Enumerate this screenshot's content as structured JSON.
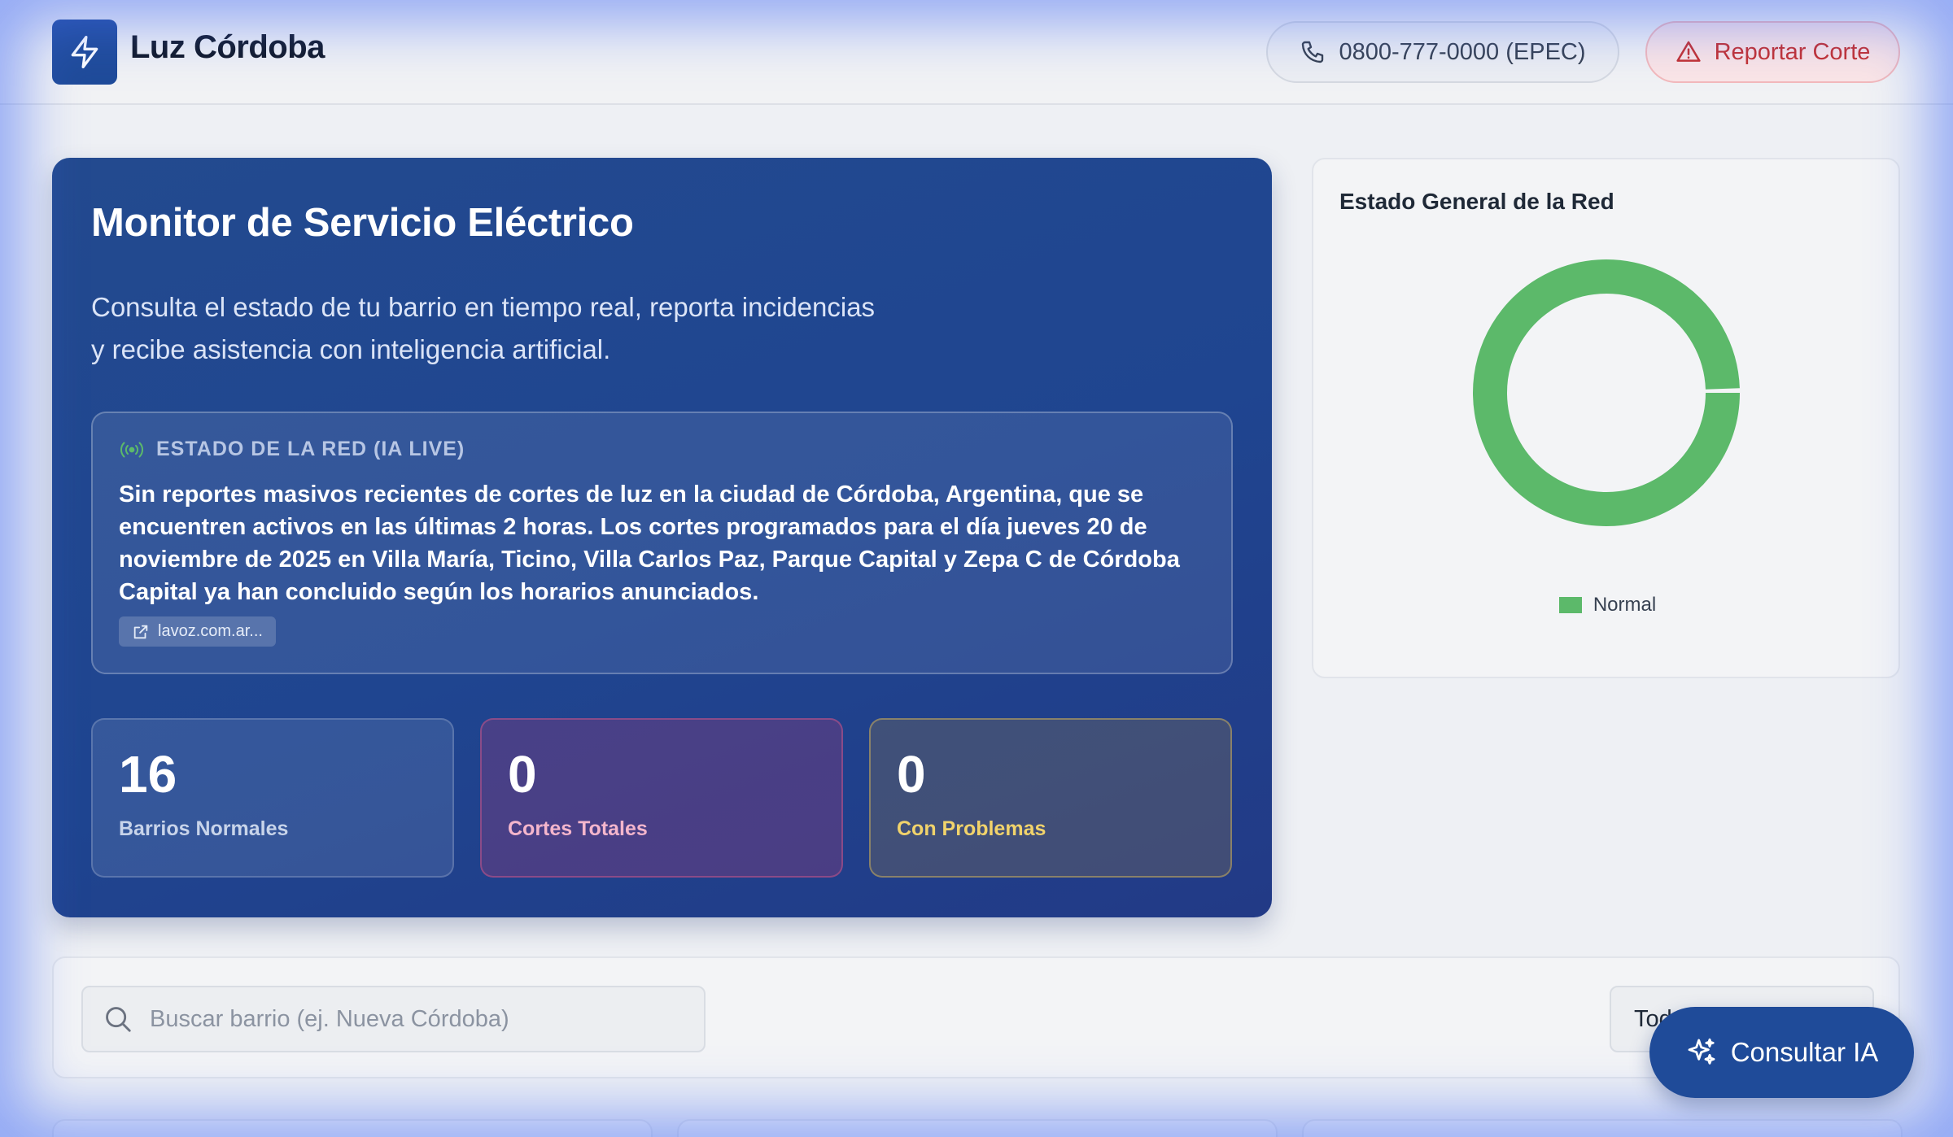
{
  "header": {
    "brand": "Luz Córdoba",
    "phone_label": "0800-777-0000 (EPEC)",
    "report_label": "Reportar Corte"
  },
  "hero": {
    "title": "Monitor de Servicio Eléctrico",
    "subtitle_line1": "Consulta el estado de tu barrio en tiempo real, reporta incidencias",
    "subtitle_line2": "y recibe asistencia con inteligencia artificial.",
    "live": {
      "title": "ESTADO DE LA RED (IA LIVE)",
      "text": "Sin reportes masivos recientes de cortes de luz en la ciudad de Córdoba, Argentina, que se encuentren activos en las últimas 2 horas. Los cortes programados para el día jueves 20 de noviembre de 2025 en Villa María, Ticino, Villa Carlos Paz, Parque Capital y Zepa C de Córdoba Capital ya han concluido según los horarios anunciados.",
      "source": "lavoz.com.ar..."
    },
    "stats": [
      {
        "value": "16",
        "label": "Barrios Normales"
      },
      {
        "value": "0",
        "label": "Cortes Totales"
      },
      {
        "value": "0",
        "label": "Con Problemas"
      }
    ]
  },
  "network": {
    "title": "Estado General de la Red",
    "legend_label": "Normal"
  },
  "chart_data": {
    "type": "pie",
    "categories": [
      "Normal",
      "Cortes Totales",
      "Con Problemas"
    ],
    "values": [
      16,
      0,
      0
    ],
    "legend": [
      "Normal"
    ],
    "colors": [
      "#5cb96a"
    ],
    "title": "Estado General de la Red"
  },
  "search": {
    "placeholder": "Buscar barrio (ej. Nueva Córdoba)",
    "filter_value": "Todos"
  },
  "ai_button": {
    "label": "Consultar IA"
  },
  "icons": {
    "logo": "bolt-icon",
    "phone": "phone-icon",
    "report": "alert-triangle-icon",
    "live": "broadcast-icon",
    "source": "external-link-icon",
    "search": "search-icon",
    "ai": "sparkles-icon"
  },
  "colors": {
    "brand_blue": "#1f4b99",
    "normal_green": "#5cb96a",
    "alert_red": "#c53030"
  }
}
